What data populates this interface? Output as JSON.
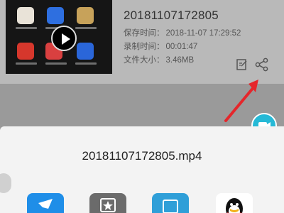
{
  "recording": {
    "title": "20181107172805",
    "saved_label": "保存时间：",
    "saved_value": "2018-11-07 17:29:52",
    "duration_label": "录制时间：",
    "duration_value": "00:01:47",
    "size_label": "文件大小：",
    "size_value": "3.46MB"
  },
  "share_sheet": {
    "filename": "20181107172805.mp4"
  },
  "icons": {
    "edit": "edit-icon",
    "share": "share-icon",
    "play": "play-icon",
    "camera": "camera-icon"
  },
  "colors": {
    "accent": "#26b9d6",
    "arrow": "#e5262b"
  }
}
